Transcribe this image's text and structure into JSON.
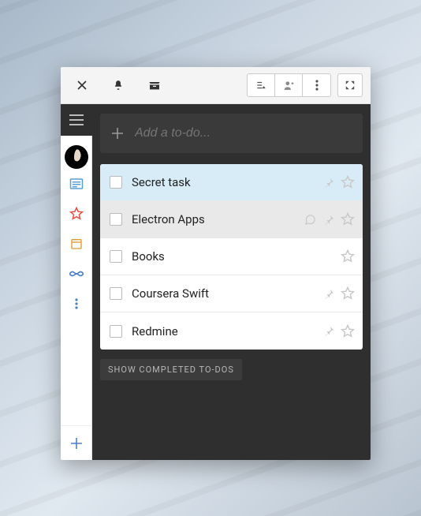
{
  "addTodoPlaceholder": "Add a to-do...",
  "items": [
    {
      "label": "Secret task",
      "selected": true,
      "sub": false,
      "pin": true,
      "comment": false
    },
    {
      "label": "Electron Apps",
      "selected": false,
      "sub": true,
      "pin": true,
      "comment": true
    },
    {
      "label": "Books",
      "selected": false,
      "sub": false,
      "pin": false,
      "comment": false
    },
    {
      "label": "Coursera Swift",
      "selected": false,
      "sub": false,
      "pin": true,
      "comment": false
    },
    {
      "label": "Redmine",
      "selected": false,
      "sub": false,
      "pin": true,
      "comment": false
    }
  ],
  "showCompleted": "SHOW COMPLETED TO-DOS"
}
